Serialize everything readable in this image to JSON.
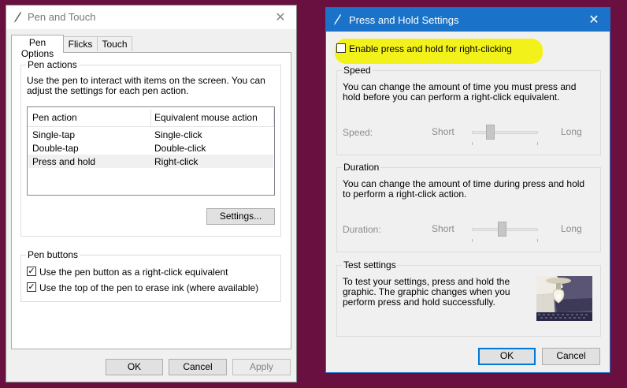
{
  "pen_and_touch": {
    "title": "Pen and Touch",
    "tabs": [
      "Pen Options",
      "Flicks",
      "Touch"
    ],
    "pen_actions": {
      "label": "Pen actions",
      "description": "Use the pen to interact with items on the screen.  You can adjust the settings for each pen action.",
      "columns": [
        "Pen action",
        "Equivalent mouse action"
      ],
      "rows": [
        {
          "action": "Single-tap",
          "mouse": "Single-click"
        },
        {
          "action": "Double-tap",
          "mouse": "Double-click"
        },
        {
          "action": "Press and hold",
          "mouse": "Right-click"
        }
      ],
      "settings_button": "Settings..."
    },
    "pen_buttons": {
      "label": "Pen buttons",
      "right_click_option": "Use the pen button as a right-click equivalent",
      "erase_option": "Use the top of the pen to erase ink (where available)"
    },
    "buttons": {
      "ok": "OK",
      "cancel": "Cancel",
      "apply": "Apply"
    }
  },
  "press_and_hold": {
    "title": "Press and Hold Settings",
    "enable_label": "Enable press and hold for right-clicking",
    "enable_checked": false,
    "speed": {
      "label": "Speed",
      "description": "You can change the amount of time you must press and hold before you can perform a right-click equivalent.",
      "slider_label": "Speed:",
      "min_label": "Short",
      "max_label": "Long",
      "value_fraction": 0.25
    },
    "duration": {
      "label": "Duration",
      "description": "You can change the amount of time during press and hold to perform a right-click action.",
      "slider_label": "Duration:",
      "min_label": "Short",
      "max_label": "Long",
      "value_fraction": 0.45
    },
    "test": {
      "label": "Test settings",
      "description": "To test your settings, press and hold the graphic. The graphic changes when you perform press and hold successfully."
    },
    "buttons": {
      "ok": "OK",
      "cancel": "Cancel"
    }
  },
  "colors": {
    "desktop": "#6a1040",
    "titlebar_active": "#1a73c9",
    "highlight": "#f2f21a",
    "focus_border": "#0078d7"
  }
}
